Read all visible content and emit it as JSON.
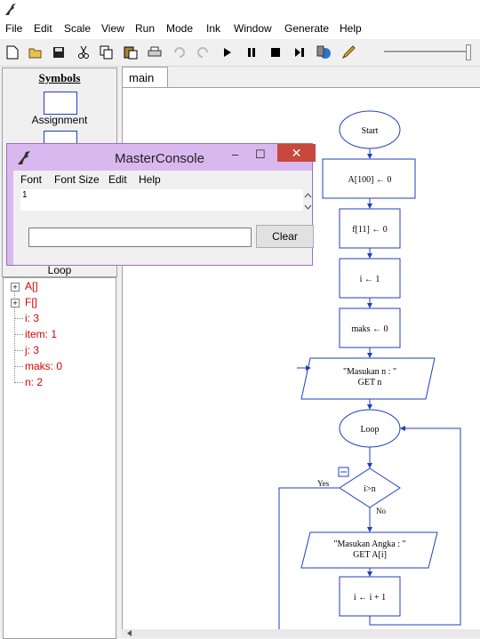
{
  "menu": [
    "File",
    "Edit",
    "Scale",
    "View",
    "Run",
    "Mode",
    "Ink",
    "Window",
    "Generate",
    "Help"
  ],
  "symbols": {
    "title": "Symbols",
    "assignment_label": "Assignment",
    "loop_label": "Loop"
  },
  "tree": [
    {
      "label": "A[]",
      "expandable": true
    },
    {
      "label": "F[]",
      "expandable": true
    },
    {
      "label": "i: 3",
      "expandable": false
    },
    {
      "label": "item: 1",
      "expandable": false
    },
    {
      "label": "j: 3",
      "expandable": false
    },
    {
      "label": "maks: 0",
      "expandable": false
    },
    {
      "label": "n: 2",
      "expandable": false
    }
  ],
  "tab": {
    "label": "main"
  },
  "console": {
    "title": "MasterConsole",
    "menu": [
      "Font",
      "Font Size",
      "Edit",
      "Help"
    ],
    "output": "1",
    "input_value": "",
    "clear_label": "Clear",
    "minimize": "–",
    "maximize": "☐",
    "close": "✕"
  },
  "flowchart": {
    "start": "Start",
    "step1": "A[100] ← 0",
    "step2": "f[11] ← 0",
    "step3": "i ← 1",
    "step4": "maks ← 0",
    "input1_line1": "\"Masukan n : \"",
    "input1_line2": "GET n",
    "loop": "Loop",
    "decision": "i>n",
    "yes": "Yes",
    "no": "No",
    "input2_line1": "\"Masukan Angka : \"",
    "input2_line2": "GET A[i]",
    "step5": "i ← i + 1"
  },
  "colors": {
    "shape_stroke": "#1f3fbf",
    "tree_text": "#e00000",
    "console_frame": "#d9b8ef",
    "close": "#c9483c"
  }
}
